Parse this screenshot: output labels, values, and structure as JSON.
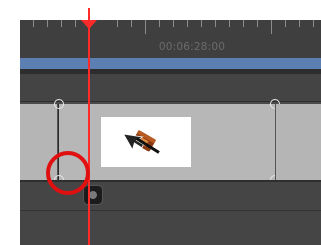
{
  "ruler": {
    "timecode": "00:06:28:00"
  },
  "timeline": {
    "clip_icon": "cursor-over-file-icon",
    "keyframe_icon": "keyframe-marker-icon",
    "playhead_color": "#ff2b2b",
    "track_color": "#5b7fb3",
    "highlight_color": "#e01010"
  }
}
